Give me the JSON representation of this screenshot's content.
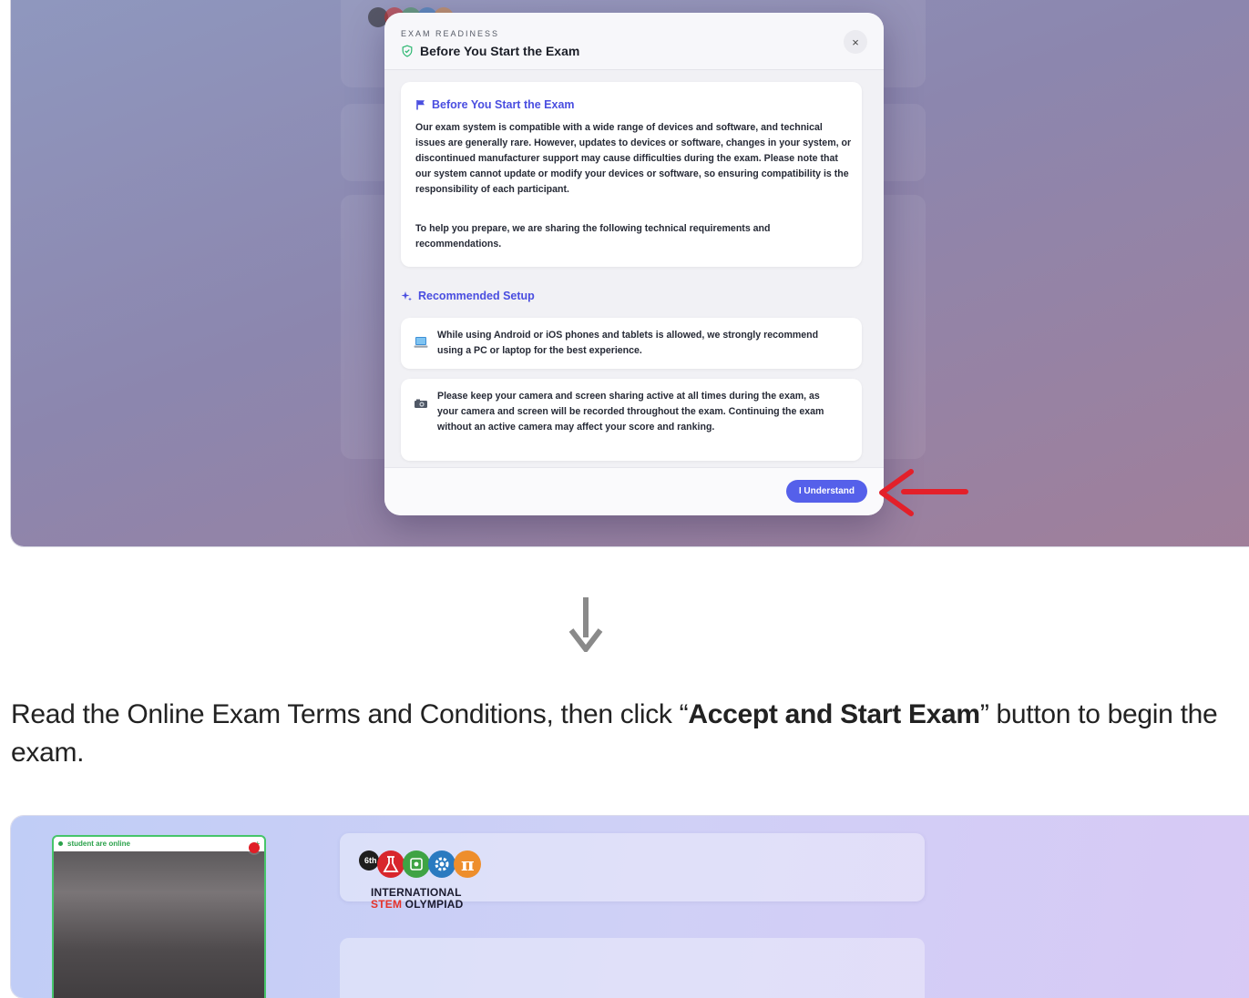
{
  "modal": {
    "kicker": "EXAM READINESS",
    "title": "Before You Start the Exam",
    "close_label": "×",
    "intro": {
      "title": "Before You Start the Exam",
      "paragraph1": "Our exam system is compatible with a wide range of devices and software, and technical issues are generally rare. However, updates to devices or software, changes in your system, or discontinued manufacturer support may cause difficulties during the exam. Please note that our system cannot update or modify your devices or software, so ensuring compatibility is the responsibility of each participant.",
      "paragraph2": "To help you prepare, we are sharing the following technical requirements and recommendations."
    },
    "recommended": {
      "title": "Recommended Setup",
      "items": [
        {
          "icon": "laptop-icon",
          "text": "While using Android or iOS phones and tablets is allowed, we strongly recommend using a PC or laptop for the best experience."
        },
        {
          "icon": "camera-icon",
          "text": "Please keep your camera and screen sharing active at all times during the exam, as your camera and screen will be recorded throughout the exam. Continuing the exam without an active camera may affect your score and ranking."
        }
      ]
    },
    "understand_button": "I Understand"
  },
  "instruction": {
    "before": "Read the Online Exam Terms and Conditions, then click “",
    "bold": "Accept and Start Exam",
    "after": "” button to begin the exam."
  },
  "bottom": {
    "camera_status": "student are online",
    "camera_plus": "+",
    "logo": {
      "badge": "6th",
      "pi": "π",
      "line1": "INTERNATIONAL",
      "line2_highlight": "STEM",
      "line2_rest": " OLYMPIAD"
    }
  },
  "colors": {
    "accent": "#5560ea",
    "arrow_red": "#e3202a",
    "online_green": "#2aa14a"
  }
}
